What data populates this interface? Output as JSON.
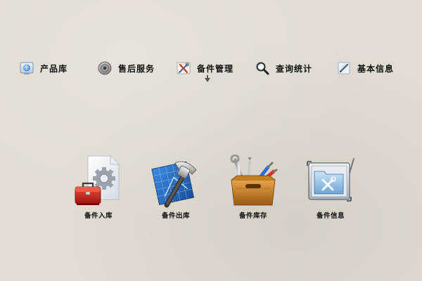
{
  "nav": {
    "items": [
      {
        "label": "产品库",
        "icon": "globe-screen-icon"
      },
      {
        "label": "售后服务",
        "icon": "speaker-icon"
      },
      {
        "label": "备件管理",
        "icon": "tools-crossed-icon"
      },
      {
        "label": "查询统计",
        "icon": "magnifier-icon"
      },
      {
        "label": "基本信息",
        "icon": "pen-paper-icon"
      }
    ]
  },
  "tiles": [
    {
      "label": "备件入库",
      "icon": "toolbox-gear-icon"
    },
    {
      "label": "备件出库",
      "icon": "hammer-blueprint-icon"
    },
    {
      "label": "备件库存",
      "icon": "wooden-toolbox-icon"
    },
    {
      "label": "备件信息",
      "icon": "tools-folder-icon"
    }
  ]
}
